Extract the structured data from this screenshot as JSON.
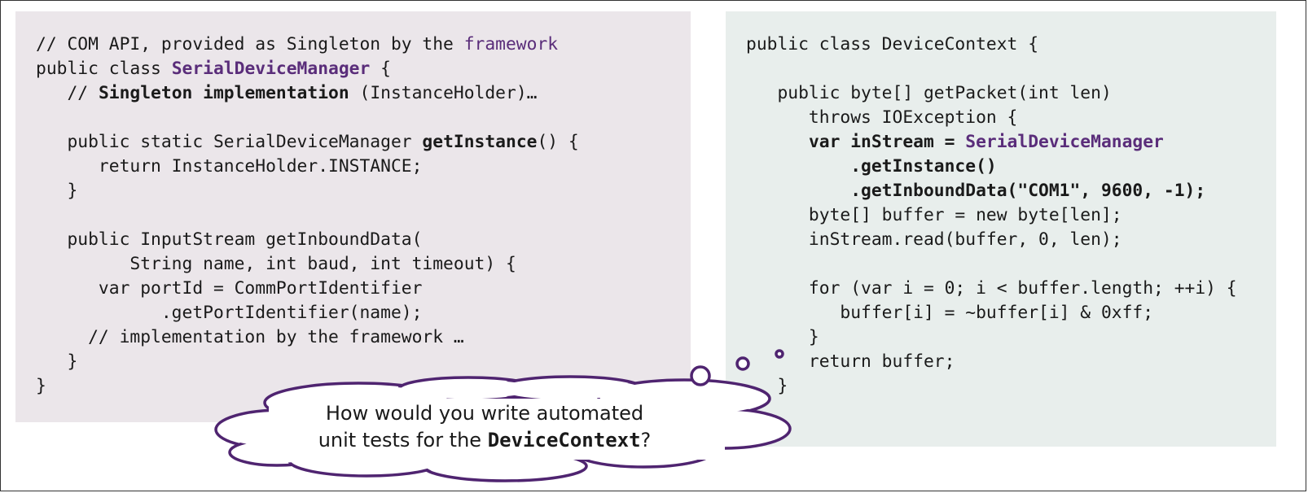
{
  "left_code": {
    "l1": {
      "a": "// COM API, provided as Singleton by the ",
      "b": "framework"
    },
    "l2": {
      "a": "public class ",
      "b": "SerialDeviceManager",
      "c": " {"
    },
    "l3": {
      "a": "   // ",
      "b": "Singleton implementation",
      "c": " (InstanceHolder)…"
    },
    "l4": "",
    "l5": {
      "a": "   public static SerialDeviceManager ",
      "b": "getInstance",
      "c": "() {"
    },
    "l6": "      return InstanceHolder.INSTANCE;",
    "l7": "   }",
    "l8": "",
    "l9": "   public InputStream getInboundData(",
    "l10": "         String name, int baud, int timeout) {",
    "l11": "      var portId = CommPortIdentifier",
    "l12": "            .getPortIdentifier(name);",
    "l13": "     // implementation by the framework …",
    "l14": "   }",
    "l15": "}"
  },
  "right_code": {
    "l1": "public class DeviceContext {",
    "l2": "",
    "l3": "   public byte[] getPacket(int len)",
    "l4": "      throws IOException {",
    "l5": {
      "a": "      ",
      "b": "var inStream = ",
      "c": "SerialDeviceManager"
    },
    "l6": "          .getInstance()",
    "l7": "          .getInboundData(\"COM1\", 9600, -1);",
    "l8": "      byte[] buffer = new byte[len];",
    "l9": "      inStream.read(buffer, 0, len);",
    "l10": "",
    "l11": "      for (var i = 0; i < buffer.length; ++i) {",
    "l12": "         buffer[i] = ~buffer[i] & 0xff;",
    "l13": "      }",
    "l14": "      return buffer;",
    "l15": "   }"
  },
  "callout": {
    "line1": "How would you write automated",
    "line2_a": "unit tests for the ",
    "line2_b": "DeviceContext",
    "line2_c": "?"
  },
  "colors": {
    "left_panel": "#ebe6ea",
    "right_panel": "#e8eeec",
    "accent_purple": "#5a2d7a",
    "cloud_outline": "#4f2470"
  }
}
